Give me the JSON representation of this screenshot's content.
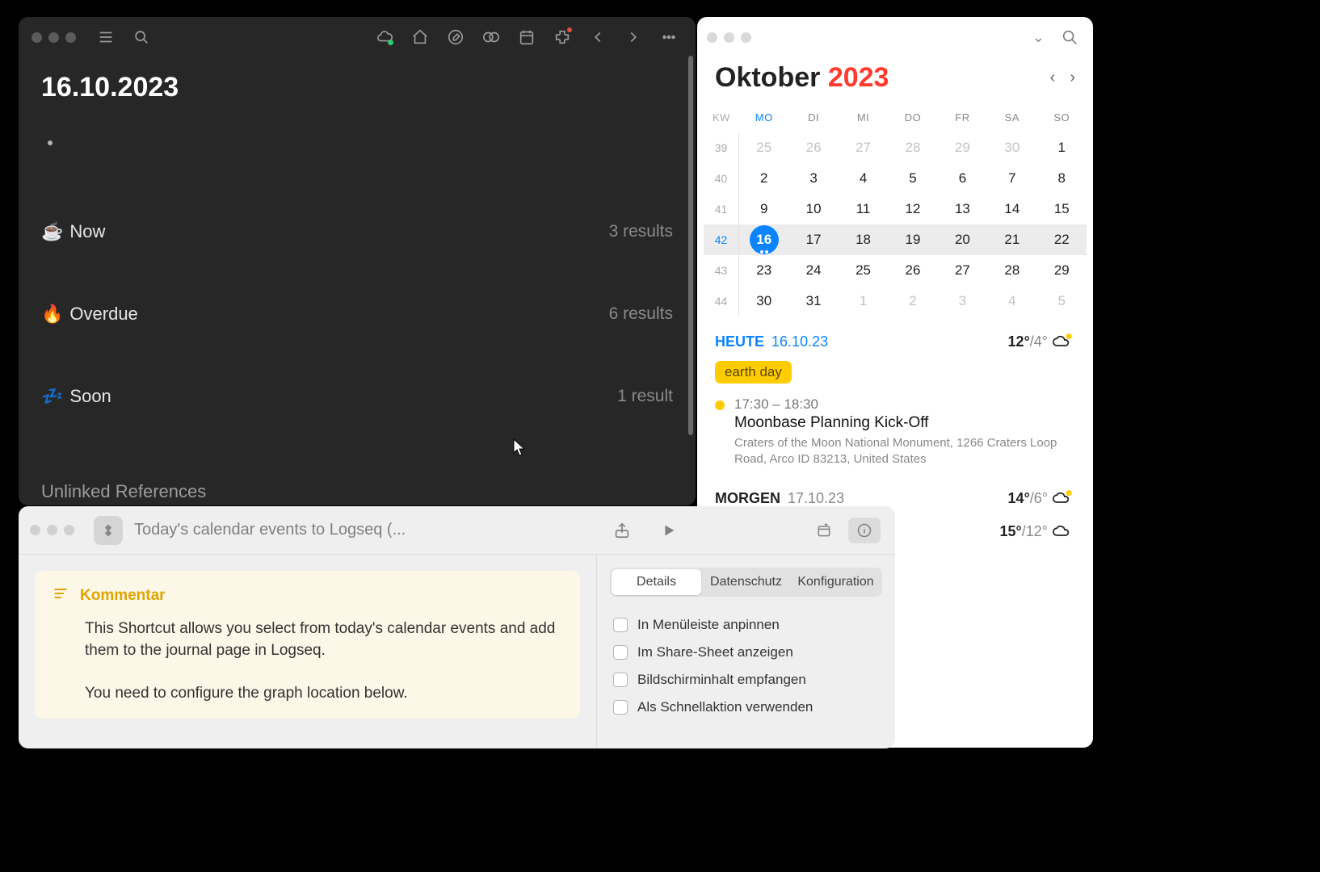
{
  "logseq": {
    "journal_title": "16.10.2023",
    "queries": [
      {
        "icon": "☕",
        "label": "Now",
        "count": "3 results"
      },
      {
        "icon": "🔥",
        "label": "Overdue",
        "count": "6 results"
      },
      {
        "icon": "💤",
        "label": "Soon",
        "count": "1 result"
      }
    ],
    "unlinked_label": "Unlinked References"
  },
  "calendar": {
    "month": "Oktober",
    "year": "2023",
    "dow_header_wk": "KW",
    "dow": [
      "MO",
      "DI",
      "MI",
      "DO",
      "FR",
      "SA",
      "SO"
    ],
    "weeks": [
      {
        "wk": "39",
        "days": [
          {
            "n": "25",
            "other": true
          },
          {
            "n": "26",
            "other": true
          },
          {
            "n": "27",
            "other": true
          },
          {
            "n": "28",
            "other": true
          },
          {
            "n": "29",
            "other": true
          },
          {
            "n": "30",
            "other": true
          },
          {
            "n": "1"
          }
        ]
      },
      {
        "wk": "40",
        "days": [
          {
            "n": "2"
          },
          {
            "n": "3"
          },
          {
            "n": "4"
          },
          {
            "n": "5"
          },
          {
            "n": "6"
          },
          {
            "n": "7"
          },
          {
            "n": "8"
          }
        ]
      },
      {
        "wk": "41",
        "days": [
          {
            "n": "9"
          },
          {
            "n": "10"
          },
          {
            "n": "11"
          },
          {
            "n": "12"
          },
          {
            "n": "13"
          },
          {
            "n": "14"
          },
          {
            "n": "15"
          }
        ]
      },
      {
        "wk": "42",
        "selected": true,
        "days": [
          {
            "n": "16",
            "selected": true,
            "dots": 2
          },
          {
            "n": "17"
          },
          {
            "n": "18"
          },
          {
            "n": "19"
          },
          {
            "n": "20"
          },
          {
            "n": "21"
          },
          {
            "n": "22"
          }
        ]
      },
      {
        "wk": "43",
        "days": [
          {
            "n": "23"
          },
          {
            "n": "24"
          },
          {
            "n": "25"
          },
          {
            "n": "26"
          },
          {
            "n": "27"
          },
          {
            "n": "28"
          },
          {
            "n": "29"
          }
        ]
      },
      {
        "wk": "44",
        "days": [
          {
            "n": "30"
          },
          {
            "n": "31"
          },
          {
            "n": "1",
            "other": true
          },
          {
            "n": "2",
            "other": true
          },
          {
            "n": "3",
            "other": true
          },
          {
            "n": "4",
            "other": true
          },
          {
            "n": "5",
            "other": true
          }
        ]
      }
    ],
    "today": {
      "label": "HEUTE",
      "date": "16.10.23",
      "hi": "12°",
      "lo": "/4°",
      "allday": "earth day",
      "event": {
        "time": "17:30 – 18:30",
        "title": "Moonbase Planning Kick-Off",
        "location": "Craters of the Moon National Monument, 1266 Craters Loop Road, Arco ID 83213, United States"
      }
    },
    "tomorrow": {
      "label": "MORGEN",
      "date": "17.10.23",
      "hi": "14°",
      "lo": "/6°"
    },
    "extra": {
      "hi": "15°",
      "lo": "/12°"
    }
  },
  "shortcuts": {
    "title": "Today's calendar events to Logseq (...",
    "comment_label": "Kommentar",
    "comment_body_1": "This Shortcut allows you select from today's calendar events and add them to the journal page in Logseq.",
    "comment_body_2": "You need to configure the graph location below.",
    "tabs": {
      "details": "Details",
      "privacy": "Datenschutz",
      "config": "Konfiguration"
    },
    "options": {
      "pin": "In Menüleiste anpinnen",
      "share": "Im Share-Sheet anzeigen",
      "screen": "Bildschirminhalt empfangen",
      "quick": "Als Schnellaktion verwenden"
    }
  }
}
